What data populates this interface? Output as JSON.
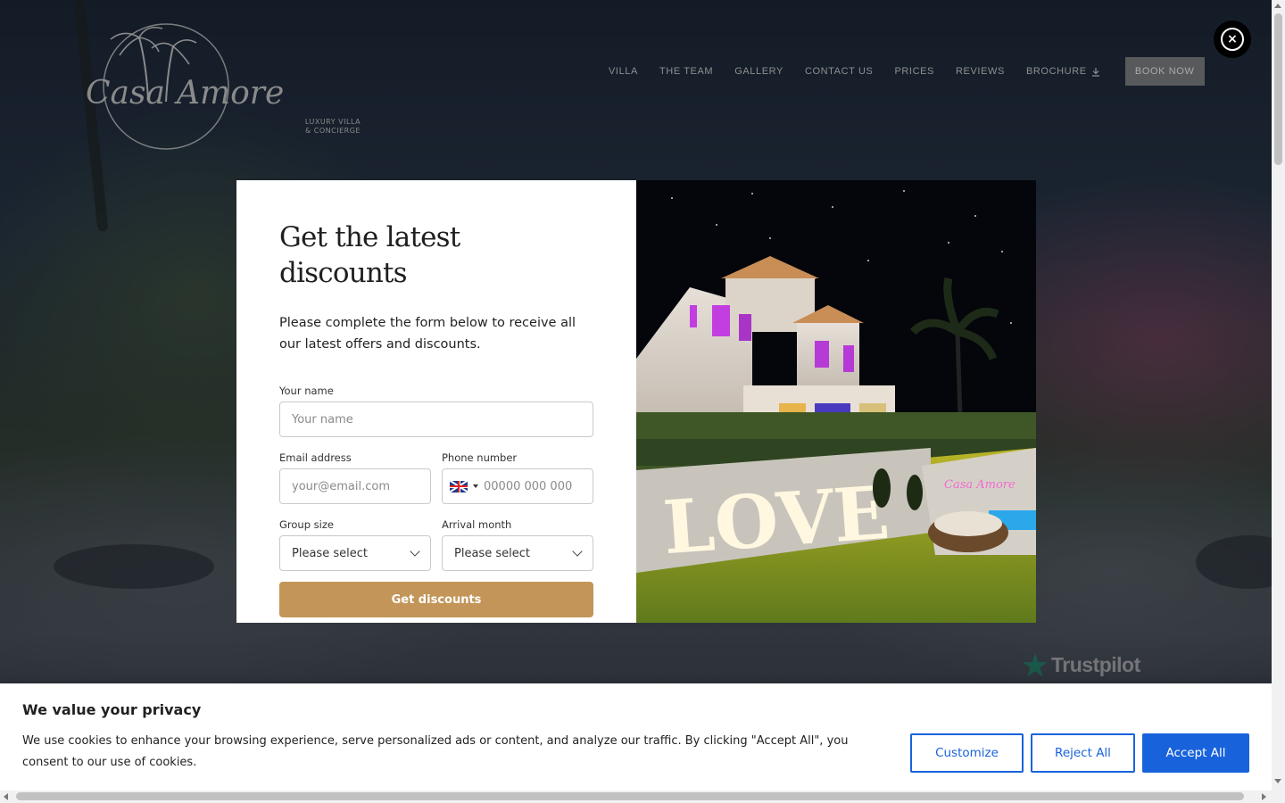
{
  "logo": {
    "script_left": "Casa",
    "script_right": "Amore",
    "tagline_1": "LUXURY VILLA",
    "tagline_2": "& CONCIERGE"
  },
  "nav": {
    "items": [
      "VILLA",
      "THE TEAM",
      "GALLERY",
      "CONTACT US",
      "PRICES",
      "REVIEWS"
    ],
    "brochure": "BROCHURE",
    "book_now": "BOOK NOW"
  },
  "trustpilot": {
    "label": "Trustpilot"
  },
  "modal": {
    "title": "Get the latest discounts",
    "description": "Please complete the form below to receive all our latest offers and discounts.",
    "name_label": "Your name",
    "name_placeholder": "Your name",
    "email_label": "Email address",
    "email_placeholder": "your@email.com",
    "phone_label": "Phone number",
    "phone_placeholder": "00000 000 000",
    "group_label": "Group size",
    "group_value": "Please select",
    "arrival_label": "Arrival month",
    "arrival_value": "Please select",
    "submit": "Get discounts",
    "image_sign": "LOVE",
    "image_neon": "Casa Amore"
  },
  "cookie": {
    "title": "We value your privacy",
    "text": "We use cookies to enhance your browsing experience, serve personalized ads or content, and analyze our traffic. By clicking \"Accept All\", you consent to our use of cookies.",
    "customize": "Customize",
    "reject": "Reject All",
    "accept": "Accept All"
  },
  "colors": {
    "accent_gold": "#c39558",
    "cookie_blue": "#1863dc",
    "book_btn": "#57595b"
  },
  "icons": [
    "close-icon",
    "download-icon",
    "trustpilot-star-icon",
    "chevron-down-icon",
    "uk-flag-icon"
  ]
}
